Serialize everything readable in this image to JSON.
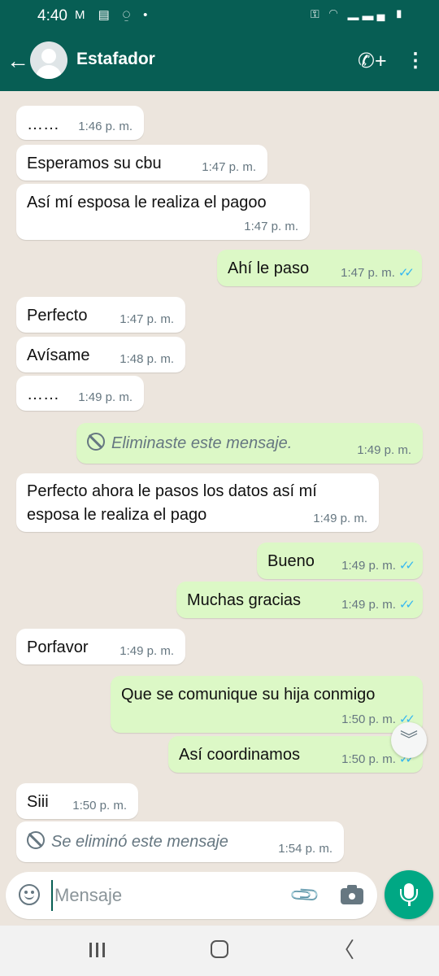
{
  "status_bar": {
    "time": "4:40",
    "notif_icons": "M ▤ ⍜ •",
    "system_icons": "⚿ ◠ ▂▃▄ ▮"
  },
  "header": {
    "back_icon": "←",
    "name": "Estafador",
    "call_icon": "✆+",
    "menu_icon": "⋮"
  },
  "messages": [
    {
      "dir": "in",
      "text": "……",
      "time": "1:46 p. m."
    },
    {
      "dir": "in",
      "text": "Esperamos su cbu",
      "time": "1:47 p. m."
    },
    {
      "dir": "in",
      "text": "Así mí esposa le realiza el pagoo",
      "time": "1:47 p. m."
    },
    {
      "dir": "out",
      "text": "Ahí le paso",
      "time": "1:47 p. m.",
      "ticks": "✓✓"
    },
    {
      "dir": "in",
      "text": "Perfecto",
      "time": "1:47 p. m."
    },
    {
      "dir": "in",
      "text": "Avísame",
      "time": "1:48 p. m."
    },
    {
      "dir": "in",
      "text": "……",
      "time": "1:49 p. m."
    },
    {
      "dir": "out",
      "text": "Eliminaste este mensaje.",
      "time": "1:49 p. m.",
      "deleted": true
    },
    {
      "dir": "in",
      "text_line1": "Perfecto ahora le pasos los datos así mí",
      "text_line2": "esposa le realiza el pago",
      "time": "1:49 p. m."
    },
    {
      "dir": "out",
      "text": "Bueno",
      "time": "1:49 p. m.",
      "ticks": "✓✓"
    },
    {
      "dir": "out",
      "text": "Muchas gracias",
      "time": "1:49 p. m.",
      "ticks": "✓✓"
    },
    {
      "dir": "in",
      "text": "Porfavor",
      "time": "1:49 p. m."
    },
    {
      "dir": "out",
      "text": "Que se comunique su hija conmigo",
      "time": "1:50 p. m.",
      "ticks": "✓✓"
    },
    {
      "dir": "out",
      "text": "Así coordinamos",
      "time": "1:50 p. m.",
      "ticks": "✓✓"
    },
    {
      "dir": "in",
      "text": "Siii",
      "time": "1:50 p. m."
    },
    {
      "dir": "in",
      "text": "Se eliminó este mensaje",
      "time": "1:54 p. m.",
      "deleted": true
    }
  ],
  "scroll_down_icon": "︾",
  "composer": {
    "placeholder": "Mensaje",
    "attach_icon": "📎"
  },
  "nav": {
    "back_icon": "〈"
  },
  "colors": {
    "header": "#075E54",
    "outgoing": "#DCF8C6",
    "incoming": "#FFFFFF",
    "read_ticks": "#34B7F1",
    "mic_button": "#00A884"
  }
}
